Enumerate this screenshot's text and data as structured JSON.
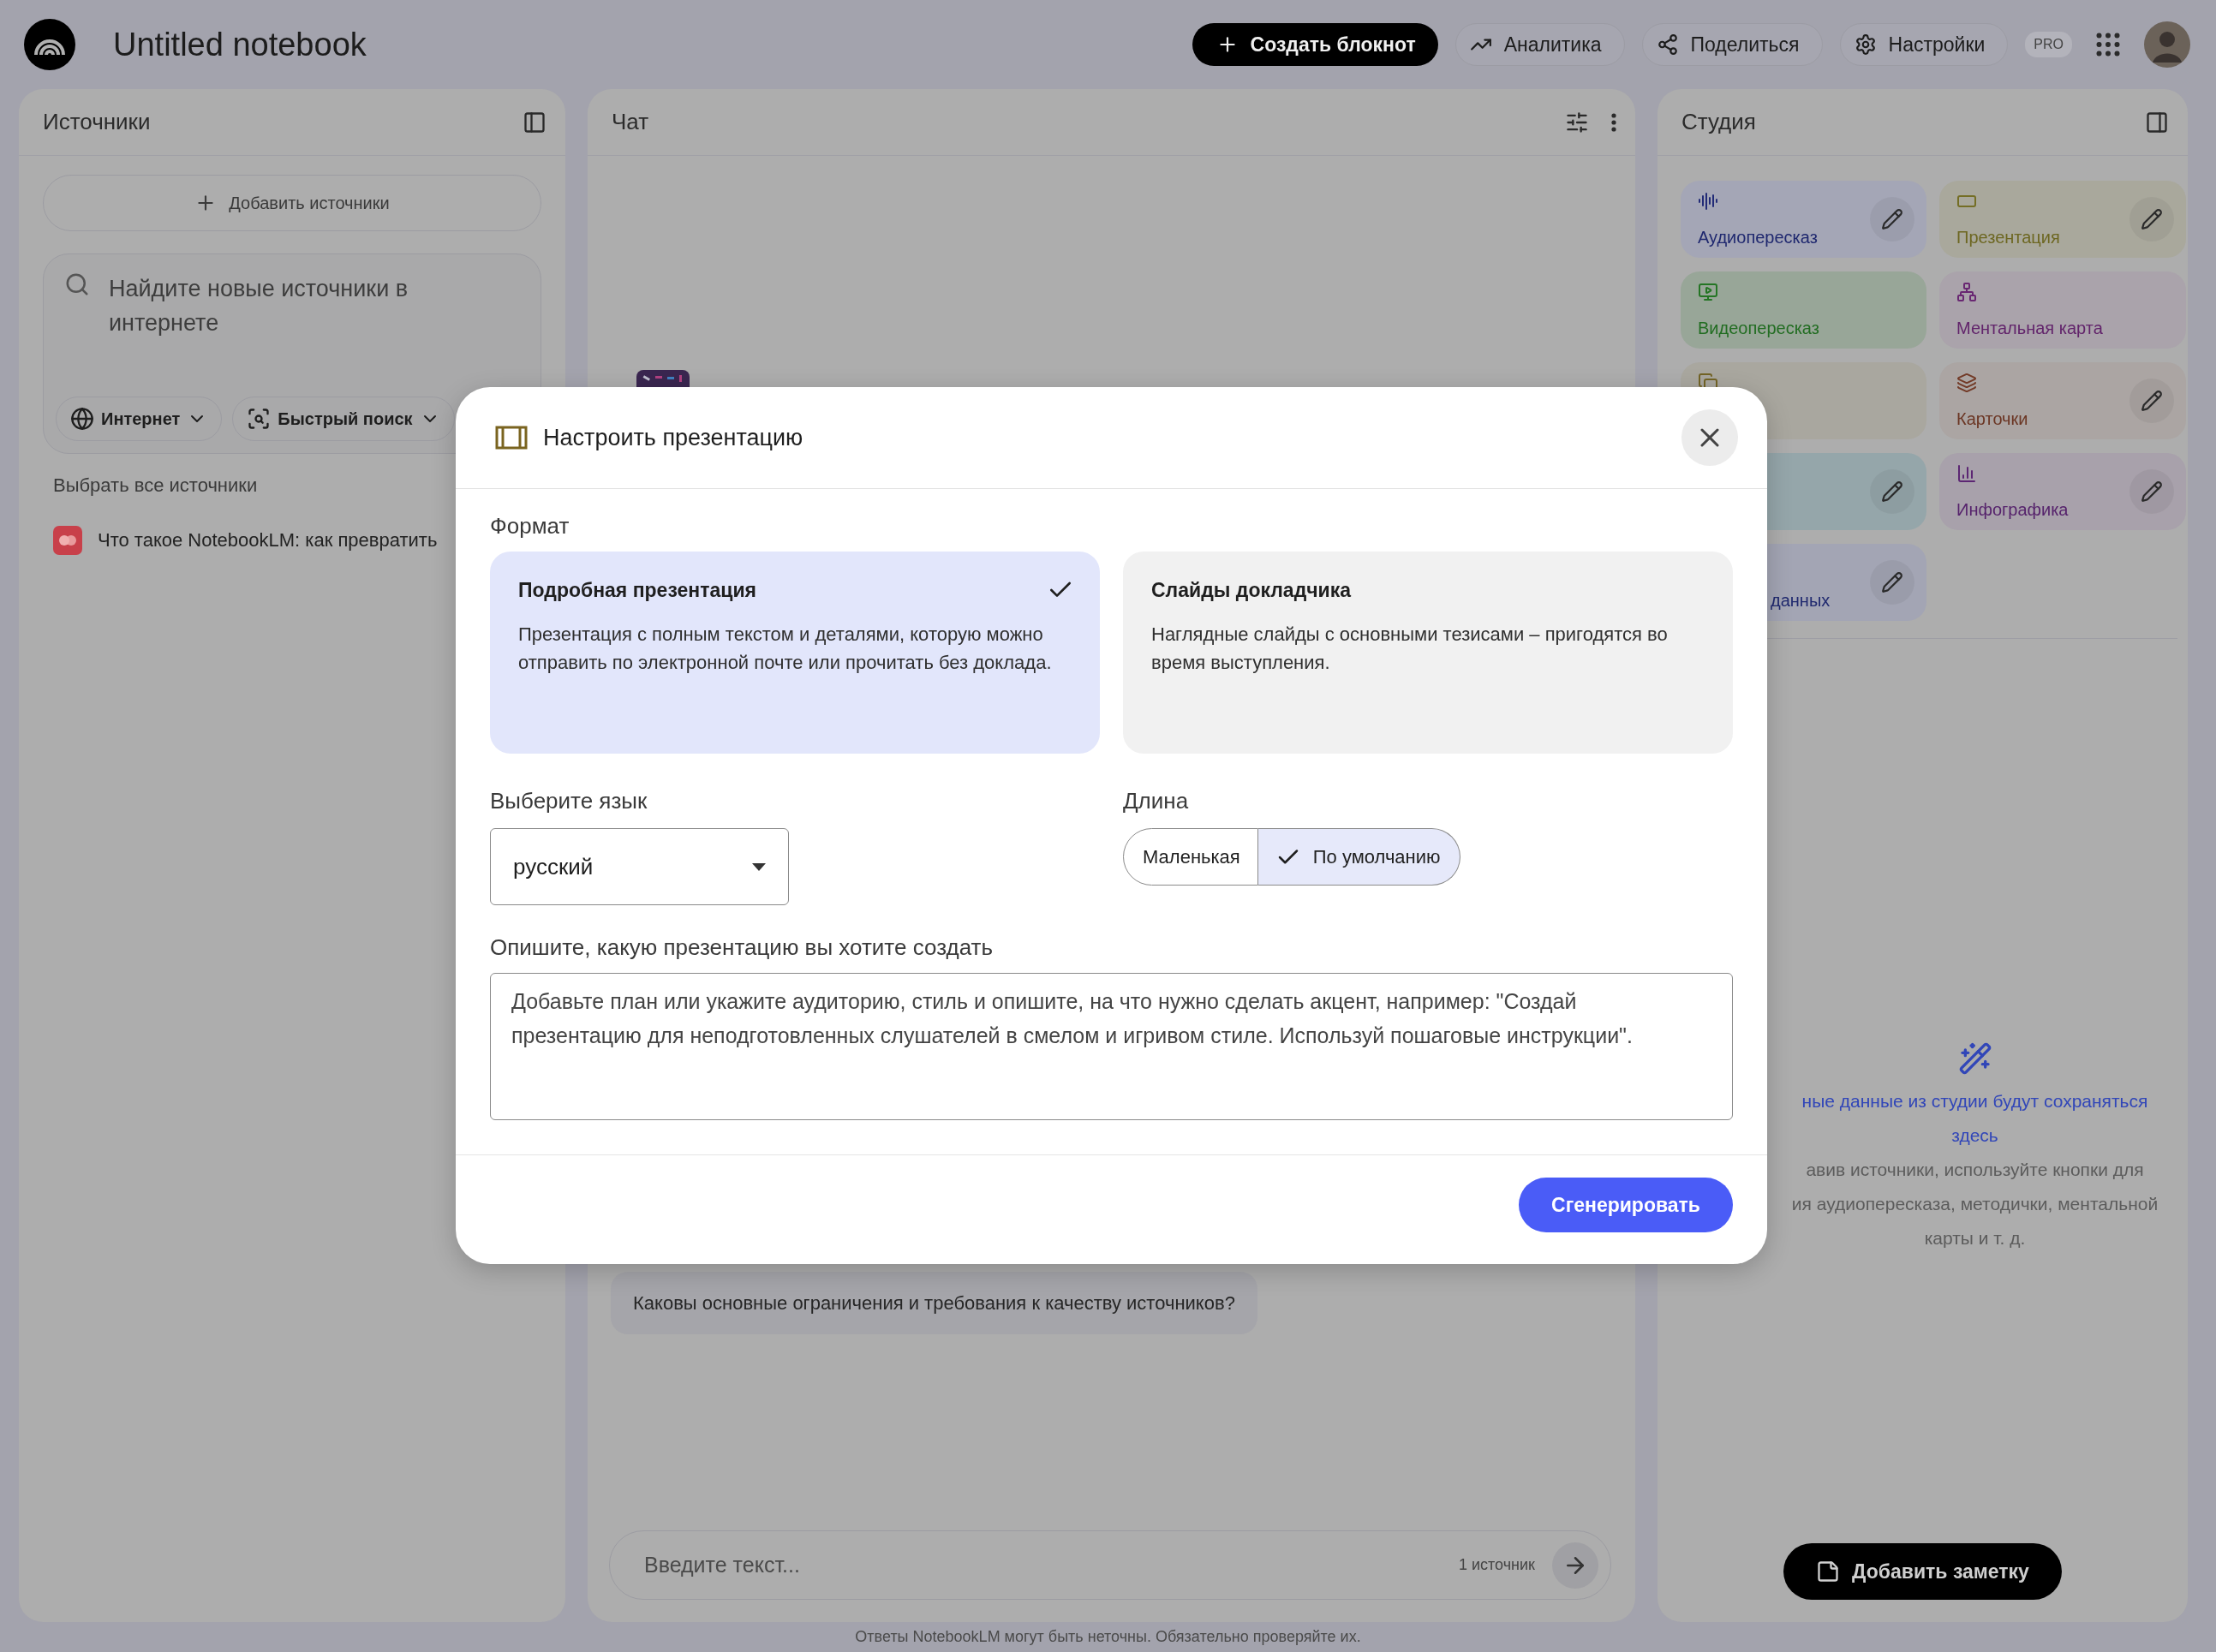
{
  "header": {
    "title": "Untitled notebook",
    "actions": [
      {
        "label": "Создать блокнот",
        "kind": "primary"
      },
      {
        "label": "Аналитика",
        "kind": "chip"
      },
      {
        "label": "Поделиться",
        "kind": "chip"
      },
      {
        "label": "Настройки",
        "kind": "chip"
      }
    ],
    "badge": "PRO"
  },
  "sources": {
    "title": "Источники",
    "add_button": "Добавить источники",
    "search": {
      "placeholder": "Найдите новые источники в интернете",
      "chips": [
        "Интернет",
        "Быстрый поиск"
      ]
    },
    "select_all": "Выбрать все источники",
    "items": [
      {
        "title": "Что такое NotebookLM: как превратить"
      }
    ]
  },
  "chat": {
    "title": "Чат",
    "suggestion": "Каковы основные ограничения и требования к качеству источников?",
    "input": {
      "placeholder": "Введите текст...",
      "source_count": "1 источник"
    }
  },
  "studio": {
    "title": "Студия",
    "tiles": [
      {
        "label": "Аудиопересказ",
        "color": "#a4a6b6",
        "editable": true
      },
      {
        "label": "Презентация",
        "color": "#a9a89c",
        "editable": true
      },
      {
        "label": "Видеопересказ",
        "color": "#98a698",
        "editable": false
      },
      {
        "label": "Ментальная карта",
        "color": "#aaa3ab",
        "editable": false
      },
      {
        "color": "#a9a79f",
        "editable": false
      },
      {
        "label": "Карточки",
        "color": "#aba5a3",
        "editable": true
      },
      {
        "color": "#95a6aa",
        "editable": true
      },
      {
        "label": "Инфографика",
        "color": "#a8a1ab",
        "editable": true
      },
      {
        "label": "данных",
        "color": "#a3a5b4",
        "editable": true
      }
    ],
    "empty_state": {
      "title_lines": [
        "ные данные из студии будут сохраняться",
        "здесь"
      ],
      "body_lines": [
        "авив источники, используйте кнопки для",
        "ия аудиопересказа, методички, ментальной",
        "карты и т. д."
      ]
    },
    "add_note": "Добавить заметку"
  },
  "footer": "Ответы NotebookLM могут быть неточны. Обязательно проверяйте их.",
  "dialog": {
    "title": "Настроить презентацию",
    "format_label": "Формат",
    "formats": [
      {
        "title": "Подробная презентация",
        "description": "Презентация с полным текстом и деталями, которую можно отправить по электронной почте или прочитать без доклада.",
        "selected": true
      },
      {
        "title": "Слайды докладчика",
        "description": "Наглядные слайды с основными тезисами – пригодятся во время выступления.",
        "selected": false
      }
    ],
    "language": {
      "label": "Выберите язык",
      "value": "русский"
    },
    "length": {
      "label": "Длина",
      "options": [
        {
          "label": "Маленькая",
          "selected": false
        },
        {
          "label": "По умолчанию",
          "selected": true
        }
      ]
    },
    "prompt": {
      "label": "Опишите, какую презентацию вы хотите создать",
      "placeholder": "Добавьте план или укажите аудиторию, стиль и опишите, на что нужно сделать акцент, например: \"Создай презентацию для неподготовленных слушателей в смелом и игривом стиле. Используй пошаговые инструкции\"."
    },
    "submit": "Сгенерировать"
  }
}
